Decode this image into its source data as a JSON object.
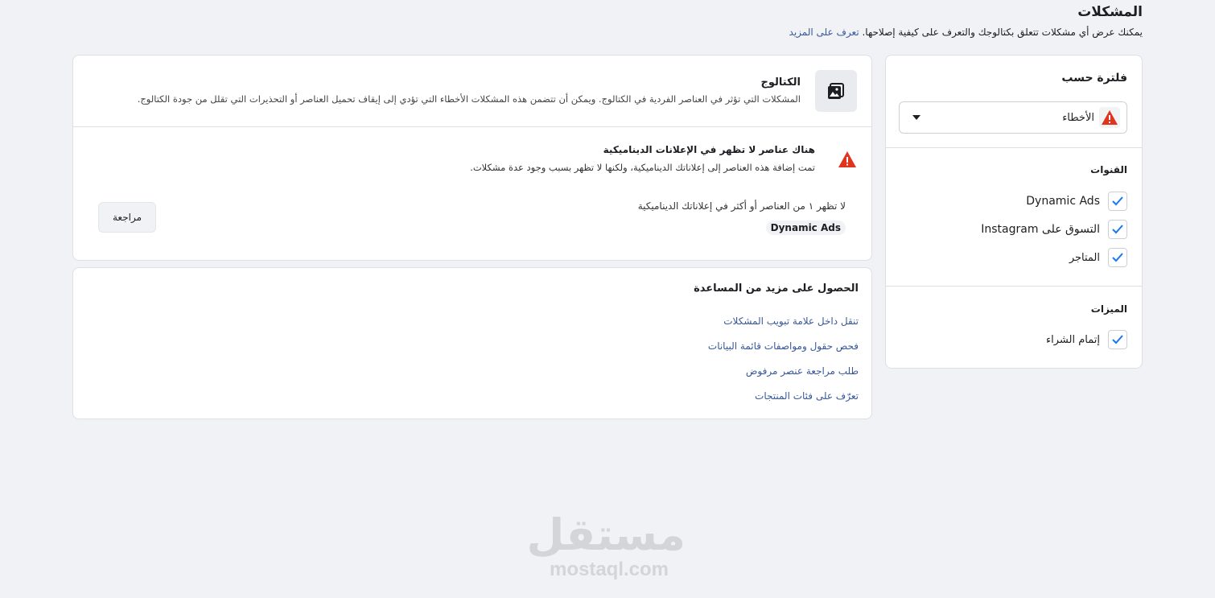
{
  "header": {
    "title": "المشكلات",
    "subtitle": "يمكنك عرض أي مشكلات تتعلق بكتالوجك والتعرف على كيفية إصلاحها.",
    "learn_more": "تعرف على المزيد"
  },
  "filter": {
    "title": "فلترة حسب",
    "select_value": "الأخطاء",
    "channels_head": "القنوات",
    "channels": [
      {
        "label": "Dynamic Ads",
        "checked": true
      },
      {
        "label": "التسوق على Instagram",
        "checked": true
      },
      {
        "label": "المتاجر",
        "checked": true
      }
    ],
    "features_head": "الميزات",
    "features": [
      {
        "label": "إتمام الشراء",
        "checked": true
      }
    ]
  },
  "catalog": {
    "title": "الكتالوج",
    "description": "المشكلات التي تؤثر في العناصر الفردية في الكتالوج. ويمكن أن تتضمن هذه المشكلات الأخطاء التي تؤدي إلى إيقاف تحميل العناصر أو التحذيرات التي تقلل من جودة الكتالوج.",
    "issue_title": "هناك عناصر لا تظهر في الإعلانات الديناميكية",
    "issue_desc": "تمت إضافة هذه العناصر إلى إعلاناتك الديناميكية، ولكنها لا تظهر بسبب وجود عدة مشكلات.",
    "issue_count": "لا تظهر ١ من العناصر أو أكثر في إعلاناتك الديناميكية",
    "tag": "Dynamic Ads",
    "review_label": "مراجعة"
  },
  "help": {
    "title": "الحصول على مزيد من المساعدة",
    "links": [
      "تنقل داخل علامة تبويب المشكلات",
      "فحص حقول ومواصفات قائمة البيانات",
      "طلب مراجعة عنصر مرفوض",
      "تعرّف على فئات المنتجات"
    ]
  },
  "watermark": {
    "arabic": "مستقل",
    "latin": "mostaql.com"
  },
  "colors": {
    "accent": "#1877f2",
    "link": "#385898",
    "warning": "#e0341e"
  }
}
